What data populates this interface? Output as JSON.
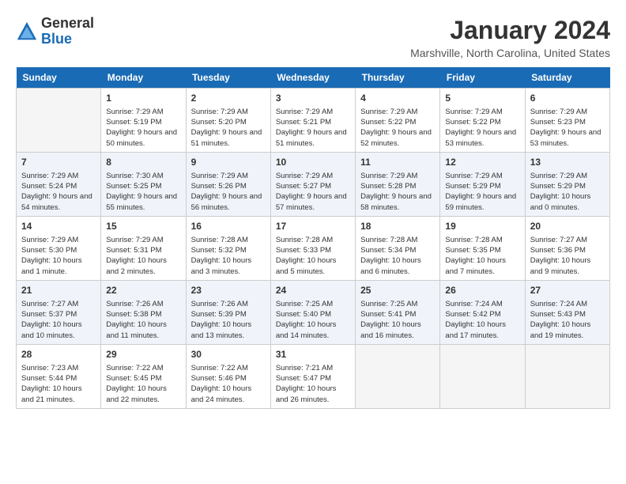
{
  "logo": {
    "general": "General",
    "blue": "Blue"
  },
  "title": "January 2024",
  "location": "Marshville, North Carolina, United States",
  "days_of_week": [
    "Sunday",
    "Monday",
    "Tuesday",
    "Wednesday",
    "Thursday",
    "Friday",
    "Saturday"
  ],
  "weeks": [
    [
      {
        "day": "",
        "sunrise": "",
        "sunset": "",
        "daylight": ""
      },
      {
        "day": "1",
        "sunrise": "Sunrise: 7:29 AM",
        "sunset": "Sunset: 5:19 PM",
        "daylight": "Daylight: 9 hours and 50 minutes."
      },
      {
        "day": "2",
        "sunrise": "Sunrise: 7:29 AM",
        "sunset": "Sunset: 5:20 PM",
        "daylight": "Daylight: 9 hours and 51 minutes."
      },
      {
        "day": "3",
        "sunrise": "Sunrise: 7:29 AM",
        "sunset": "Sunset: 5:21 PM",
        "daylight": "Daylight: 9 hours and 51 minutes."
      },
      {
        "day": "4",
        "sunrise": "Sunrise: 7:29 AM",
        "sunset": "Sunset: 5:22 PM",
        "daylight": "Daylight: 9 hours and 52 minutes."
      },
      {
        "day": "5",
        "sunrise": "Sunrise: 7:29 AM",
        "sunset": "Sunset: 5:22 PM",
        "daylight": "Daylight: 9 hours and 53 minutes."
      },
      {
        "day": "6",
        "sunrise": "Sunrise: 7:29 AM",
        "sunset": "Sunset: 5:23 PM",
        "daylight": "Daylight: 9 hours and 53 minutes."
      }
    ],
    [
      {
        "day": "7",
        "sunrise": "Sunrise: 7:29 AM",
        "sunset": "Sunset: 5:24 PM",
        "daylight": "Daylight: 9 hours and 54 minutes."
      },
      {
        "day": "8",
        "sunrise": "Sunrise: 7:30 AM",
        "sunset": "Sunset: 5:25 PM",
        "daylight": "Daylight: 9 hours and 55 minutes."
      },
      {
        "day": "9",
        "sunrise": "Sunrise: 7:29 AM",
        "sunset": "Sunset: 5:26 PM",
        "daylight": "Daylight: 9 hours and 56 minutes."
      },
      {
        "day": "10",
        "sunrise": "Sunrise: 7:29 AM",
        "sunset": "Sunset: 5:27 PM",
        "daylight": "Daylight: 9 hours and 57 minutes."
      },
      {
        "day": "11",
        "sunrise": "Sunrise: 7:29 AM",
        "sunset": "Sunset: 5:28 PM",
        "daylight": "Daylight: 9 hours and 58 minutes."
      },
      {
        "day": "12",
        "sunrise": "Sunrise: 7:29 AM",
        "sunset": "Sunset: 5:29 PM",
        "daylight": "Daylight: 9 hours and 59 minutes."
      },
      {
        "day": "13",
        "sunrise": "Sunrise: 7:29 AM",
        "sunset": "Sunset: 5:29 PM",
        "daylight": "Daylight: 10 hours and 0 minutes."
      }
    ],
    [
      {
        "day": "14",
        "sunrise": "Sunrise: 7:29 AM",
        "sunset": "Sunset: 5:30 PM",
        "daylight": "Daylight: 10 hours and 1 minute."
      },
      {
        "day": "15",
        "sunrise": "Sunrise: 7:29 AM",
        "sunset": "Sunset: 5:31 PM",
        "daylight": "Daylight: 10 hours and 2 minutes."
      },
      {
        "day": "16",
        "sunrise": "Sunrise: 7:28 AM",
        "sunset": "Sunset: 5:32 PM",
        "daylight": "Daylight: 10 hours and 3 minutes."
      },
      {
        "day": "17",
        "sunrise": "Sunrise: 7:28 AM",
        "sunset": "Sunset: 5:33 PM",
        "daylight": "Daylight: 10 hours and 5 minutes."
      },
      {
        "day": "18",
        "sunrise": "Sunrise: 7:28 AM",
        "sunset": "Sunset: 5:34 PM",
        "daylight": "Daylight: 10 hours and 6 minutes."
      },
      {
        "day": "19",
        "sunrise": "Sunrise: 7:28 AM",
        "sunset": "Sunset: 5:35 PM",
        "daylight": "Daylight: 10 hours and 7 minutes."
      },
      {
        "day": "20",
        "sunrise": "Sunrise: 7:27 AM",
        "sunset": "Sunset: 5:36 PM",
        "daylight": "Daylight: 10 hours and 9 minutes."
      }
    ],
    [
      {
        "day": "21",
        "sunrise": "Sunrise: 7:27 AM",
        "sunset": "Sunset: 5:37 PM",
        "daylight": "Daylight: 10 hours and 10 minutes."
      },
      {
        "day": "22",
        "sunrise": "Sunrise: 7:26 AM",
        "sunset": "Sunset: 5:38 PM",
        "daylight": "Daylight: 10 hours and 11 minutes."
      },
      {
        "day": "23",
        "sunrise": "Sunrise: 7:26 AM",
        "sunset": "Sunset: 5:39 PM",
        "daylight": "Daylight: 10 hours and 13 minutes."
      },
      {
        "day": "24",
        "sunrise": "Sunrise: 7:25 AM",
        "sunset": "Sunset: 5:40 PM",
        "daylight": "Daylight: 10 hours and 14 minutes."
      },
      {
        "day": "25",
        "sunrise": "Sunrise: 7:25 AM",
        "sunset": "Sunset: 5:41 PM",
        "daylight": "Daylight: 10 hours and 16 minutes."
      },
      {
        "day": "26",
        "sunrise": "Sunrise: 7:24 AM",
        "sunset": "Sunset: 5:42 PM",
        "daylight": "Daylight: 10 hours and 17 minutes."
      },
      {
        "day": "27",
        "sunrise": "Sunrise: 7:24 AM",
        "sunset": "Sunset: 5:43 PM",
        "daylight": "Daylight: 10 hours and 19 minutes."
      }
    ],
    [
      {
        "day": "28",
        "sunrise": "Sunrise: 7:23 AM",
        "sunset": "Sunset: 5:44 PM",
        "daylight": "Daylight: 10 hours and 21 minutes."
      },
      {
        "day": "29",
        "sunrise": "Sunrise: 7:22 AM",
        "sunset": "Sunset: 5:45 PM",
        "daylight": "Daylight: 10 hours and 22 minutes."
      },
      {
        "day": "30",
        "sunrise": "Sunrise: 7:22 AM",
        "sunset": "Sunset: 5:46 PM",
        "daylight": "Daylight: 10 hours and 24 minutes."
      },
      {
        "day": "31",
        "sunrise": "Sunrise: 7:21 AM",
        "sunset": "Sunset: 5:47 PM",
        "daylight": "Daylight: 10 hours and 26 minutes."
      },
      {
        "day": "",
        "sunrise": "",
        "sunset": "",
        "daylight": ""
      },
      {
        "day": "",
        "sunrise": "",
        "sunset": "",
        "daylight": ""
      },
      {
        "day": "",
        "sunrise": "",
        "sunset": "",
        "daylight": ""
      }
    ]
  ]
}
